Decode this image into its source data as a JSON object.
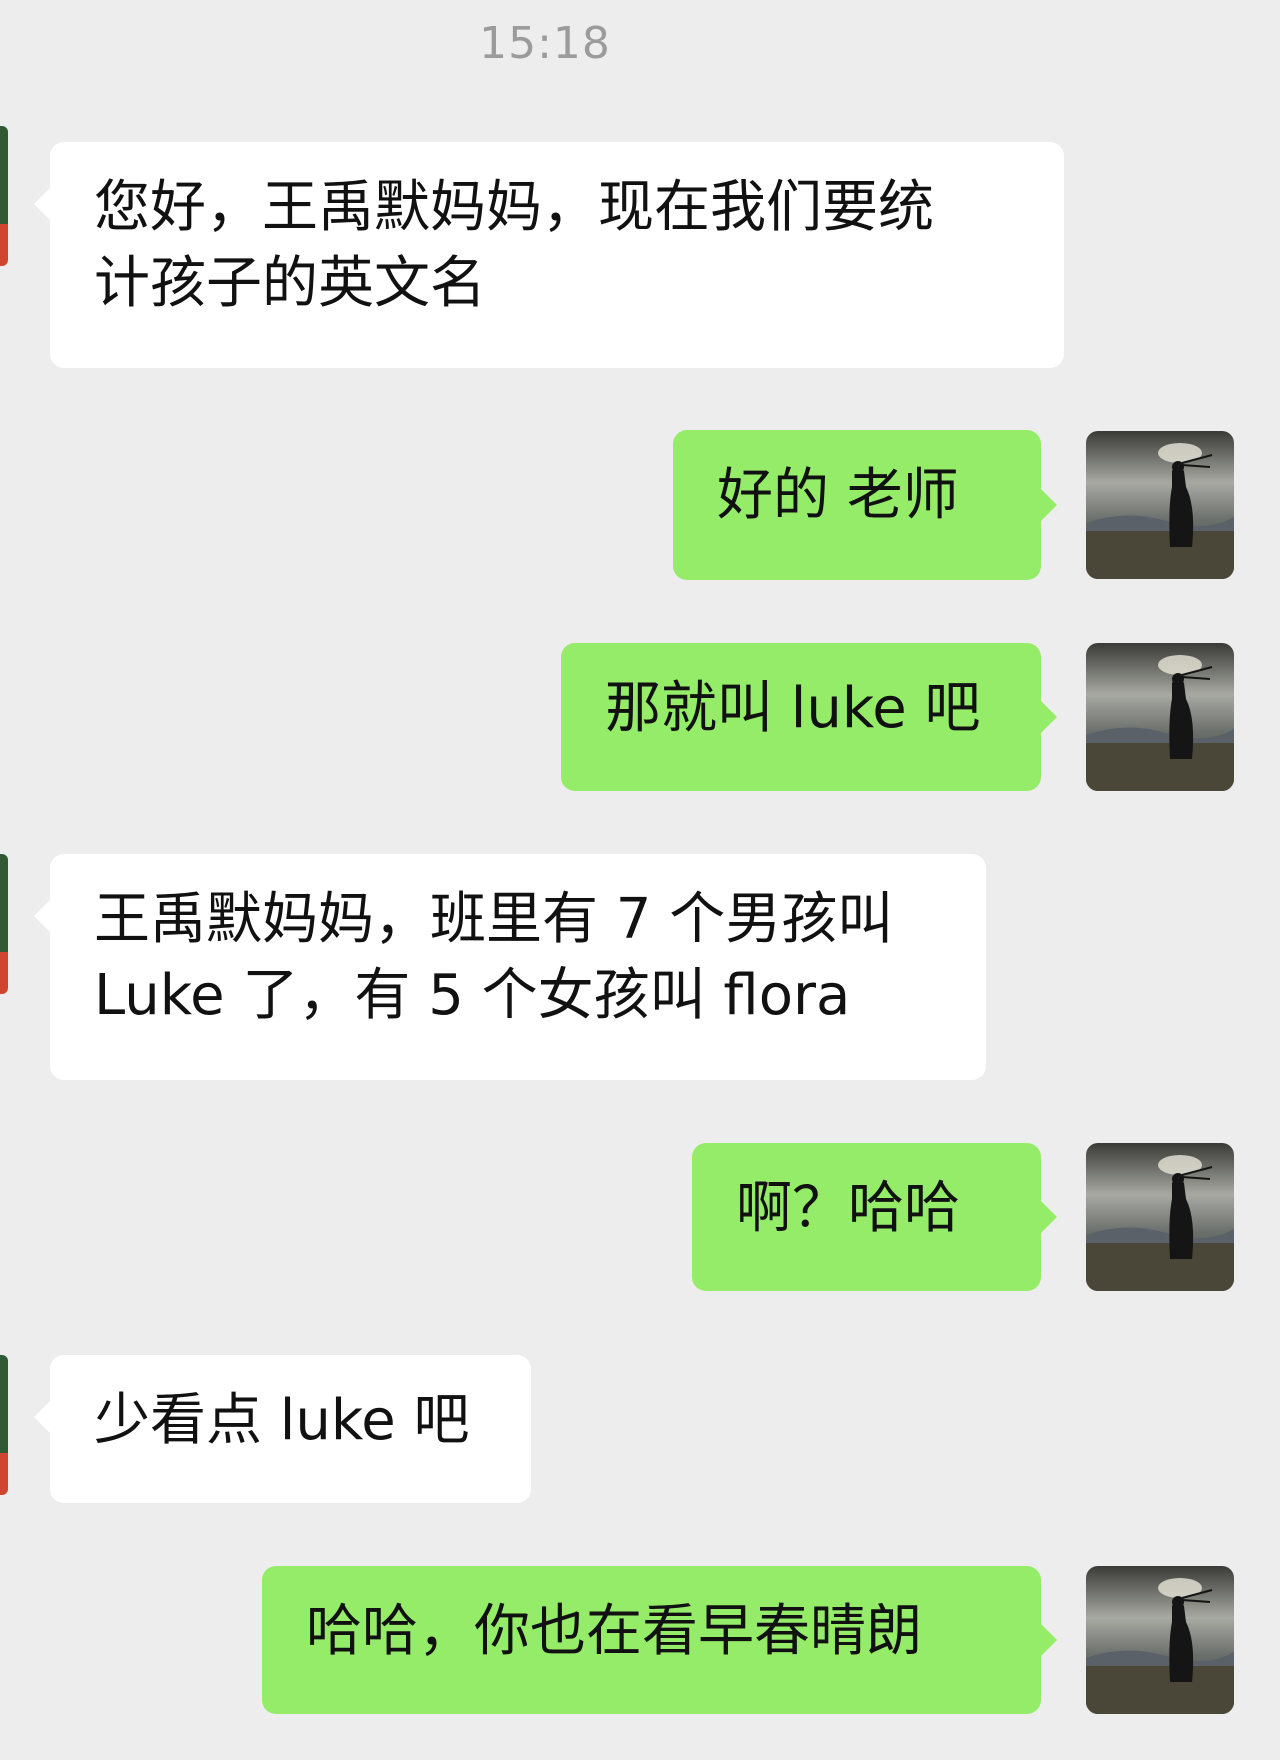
{
  "chat": {
    "timestamp": "15:18",
    "messages": [
      {
        "sender": "incoming",
        "text": "您好，王禹默妈妈，现在我们要统\n计孩子的英文名"
      },
      {
        "sender": "outgoing",
        "text": "好的 老师"
      },
      {
        "sender": "outgoing",
        "text": "那就叫 luke 吧"
      },
      {
        "sender": "incoming",
        "text": "王禹默妈妈，班里有 7 个男孩叫\nLuke 了，有 5 个女孩叫 flora"
      },
      {
        "sender": "outgoing",
        "text": "啊？哈哈"
      },
      {
        "sender": "incoming",
        "text": "少看点 luke 吧"
      },
      {
        "sender": "outgoing",
        "text": "哈哈，你也在看早春晴朗"
      }
    ]
  },
  "colors": {
    "background": "#ededed",
    "incoming_bubble": "#ffffff",
    "outgoing_bubble": "#95ec69",
    "timestamp_text": "#9b9b9b"
  },
  "icons": {
    "self_avatar": "silhouette-photo-avatar",
    "contact_avatar": "contact-avatar"
  }
}
